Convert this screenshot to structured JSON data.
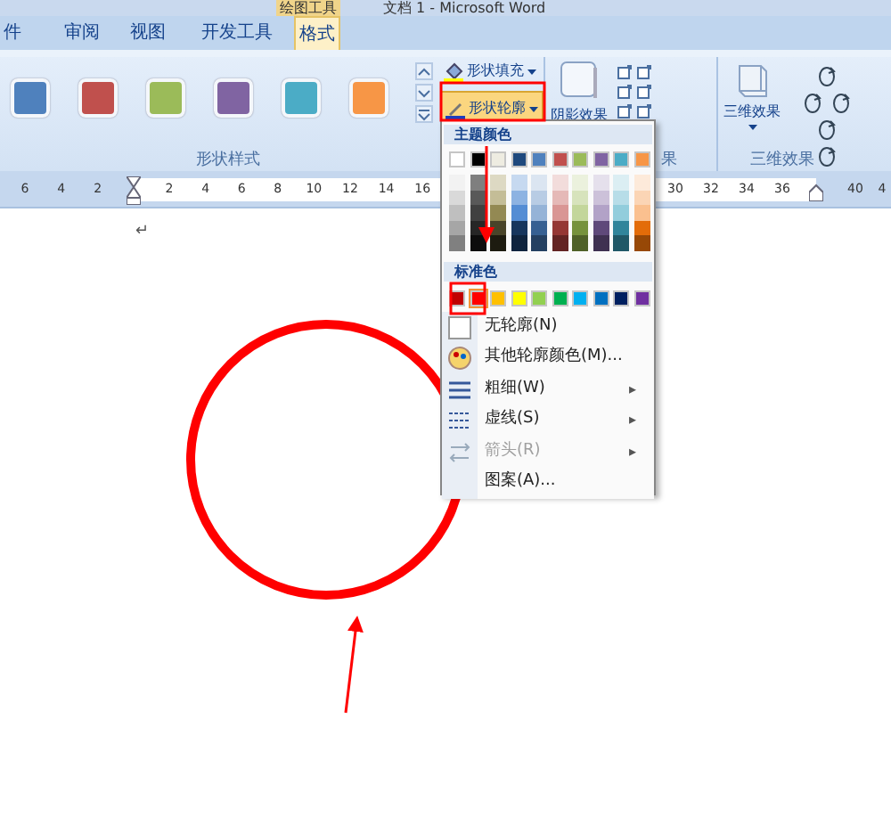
{
  "title_bar": {
    "context_tab": "绘图工具",
    "document_title": "文档 1 - Microsoft Word"
  },
  "tabs": [
    {
      "label": "件",
      "selected": false
    },
    {
      "label": "审阅",
      "selected": false
    },
    {
      "label": "视图",
      "selected": false
    },
    {
      "label": "开发工具",
      "selected": false
    },
    {
      "label": "格式",
      "selected": true
    }
  ],
  "ribbon": {
    "style_swatches": [
      {
        "color": "#4f81bd"
      },
      {
        "color": "#c0504d"
      },
      {
        "color": "#9bbb59"
      },
      {
        "color": "#8064a2"
      },
      {
        "color": "#4bacc6"
      },
      {
        "color": "#f79646"
      }
    ],
    "fill_button": {
      "label": "形状填充",
      "pressed": false
    },
    "outline_button": {
      "label": "形状轮廓",
      "pressed": true
    },
    "style_group_label": "形状样式",
    "shadow_button": "阴影效果",
    "shadow_group_label": "果",
    "three_d_button": "三维效果",
    "three_d_group_label": "三维效果"
  },
  "ruler": {
    "left_labels": [
      "6",
      "4",
      "2"
    ],
    "right_labels": [
      "2",
      "4",
      "6",
      "8",
      "10",
      "12",
      "14",
      "16"
    ],
    "far_labels": [
      "30",
      "32",
      "34",
      "36"
    ],
    "end_labels": [
      "40",
      "4"
    ]
  },
  "document": {
    "paragraph_mark": "↵"
  },
  "outline_menu": {
    "theme_header": "主题颜色",
    "theme_colors": [
      {
        "color": "#ffffff",
        "shades": [
          {
            "color": "#f2f2f2"
          },
          {
            "color": "#d9d9d9"
          },
          {
            "color": "#bfbfbf"
          },
          {
            "color": "#a6a6a6"
          },
          {
            "color": "#808080"
          }
        ]
      },
      {
        "color": "#000000",
        "shades": [
          {
            "color": "#7f7f7f"
          },
          {
            "color": "#595959"
          },
          {
            "color": "#404040"
          },
          {
            "color": "#262626"
          },
          {
            "color": "#0d0d0d"
          }
        ]
      },
      {
        "color": "#eeece1",
        "shades": [
          {
            "color": "#ddd9c3"
          },
          {
            "color": "#c4bd97"
          },
          {
            "color": "#938953"
          },
          {
            "color": "#494429"
          },
          {
            "color": "#1d1b10"
          }
        ]
      },
      {
        "color": "#1f497d",
        "shades": [
          {
            "color": "#c6d9f0"
          },
          {
            "color": "#8db3e2"
          },
          {
            "color": "#548dd4"
          },
          {
            "color": "#17365d"
          },
          {
            "color": "#0f243e"
          }
        ]
      },
      {
        "color": "#4f81bd",
        "shades": [
          {
            "color": "#dbe5f1"
          },
          {
            "color": "#b8cce4"
          },
          {
            "color": "#95b3d7"
          },
          {
            "color": "#366092"
          },
          {
            "color": "#244061"
          }
        ]
      },
      {
        "color": "#c0504d",
        "shades": [
          {
            "color": "#f2dcdb"
          },
          {
            "color": "#e5b9b7"
          },
          {
            "color": "#d99694"
          },
          {
            "color": "#953734"
          },
          {
            "color": "#632423"
          }
        ]
      },
      {
        "color": "#9bbb59",
        "shades": [
          {
            "color": "#ebf1dd"
          },
          {
            "color": "#d7e3bc"
          },
          {
            "color": "#c3d69b"
          },
          {
            "color": "#76923c"
          },
          {
            "color": "#4f6128"
          }
        ]
      },
      {
        "color": "#8064a2",
        "shades": [
          {
            "color": "#e5e0ec"
          },
          {
            "color": "#ccc1d9"
          },
          {
            "color": "#b2a2c7"
          },
          {
            "color": "#5f497a"
          },
          {
            "color": "#3f3151"
          }
        ]
      },
      {
        "color": "#4bacc6",
        "shades": [
          {
            "color": "#dbeef3"
          },
          {
            "color": "#b7dde8"
          },
          {
            "color": "#92cddc"
          },
          {
            "color": "#31859b"
          },
          {
            "color": "#205867"
          }
        ]
      },
      {
        "color": "#f79646",
        "shades": [
          {
            "color": "#fdeada"
          },
          {
            "color": "#fbd5b5"
          },
          {
            "color": "#fac08f"
          },
          {
            "color": "#e36c09"
          },
          {
            "color": "#974806"
          }
        ]
      }
    ],
    "standard_header": "标准色",
    "standard_colors": [
      {
        "color": "#c00000",
        "selected": false
      },
      {
        "color": "#ff0000",
        "selected": true
      },
      {
        "color": "#ffc000",
        "selected": false
      },
      {
        "color": "#ffff00",
        "selected": false
      },
      {
        "color": "#92d050",
        "selected": false
      },
      {
        "color": "#00b050",
        "selected": false
      },
      {
        "color": "#00b0f0",
        "selected": false
      },
      {
        "color": "#0070c0",
        "selected": false
      },
      {
        "color": "#002060",
        "selected": false
      },
      {
        "color": "#7030a0",
        "selected": false
      }
    ],
    "items": [
      {
        "kind": "none",
        "label": "无轮廓(N)",
        "disabled": false
      },
      {
        "kind": "more",
        "label": "其他轮廓颜色(M)...",
        "disabled": false
      },
      {
        "kind": "weight",
        "label": "粗细(W)",
        "disabled": false,
        "submenu_mark": "▸"
      },
      {
        "kind": "dash",
        "label": "虚线(S)",
        "disabled": false,
        "submenu_mark": "▸"
      },
      {
        "kind": "arrow",
        "label": "箭头(R)",
        "disabled": true,
        "submenu_mark": "▸"
      },
      {
        "kind": "pattern",
        "label": "图案(A)...",
        "disabled": false
      }
    ]
  }
}
